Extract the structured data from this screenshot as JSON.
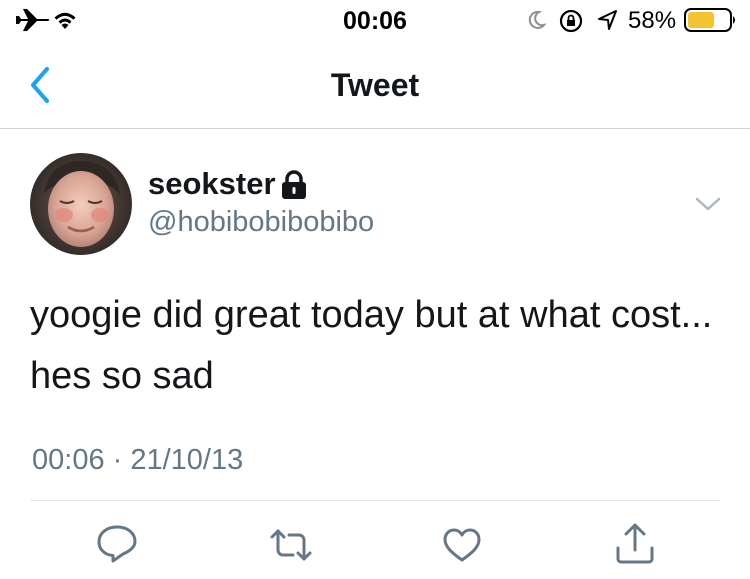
{
  "status_bar": {
    "time": "00:06",
    "battery_percent": "58%",
    "icons": [
      "airplane-icon",
      "wifi-icon",
      "moon-icon",
      "rotation-lock-icon",
      "location-icon",
      "battery-icon"
    ]
  },
  "nav": {
    "title": "Tweet",
    "back_icon": "chevron-left-icon",
    "accent_color": "#1da1f2"
  },
  "tweet": {
    "display_name": "seokster",
    "protected_icon": "lock-icon",
    "handle": "@hobibobibobibo",
    "text": "yoogie did great today but at what cost... hes so sad",
    "time": "00:06",
    "date": "21/10/13",
    "separator": " · "
  },
  "actions": [
    {
      "name": "reply",
      "icon": "reply-icon"
    },
    {
      "name": "retweet",
      "icon": "retweet-icon"
    },
    {
      "name": "like",
      "icon": "heart-icon"
    },
    {
      "name": "share",
      "icon": "share-icon"
    }
  ],
  "colors": {
    "secondary_text": "#657786",
    "icon_gray": "#657786",
    "battery_fill": "#f4c430"
  }
}
